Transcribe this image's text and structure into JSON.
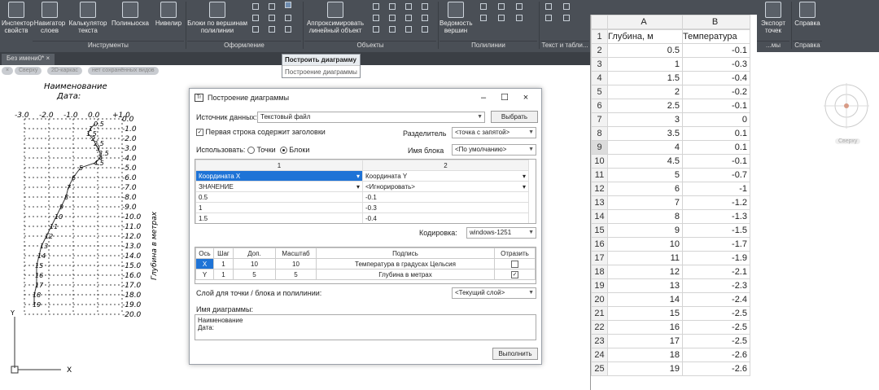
{
  "ribbon": {
    "buttons": [
      {
        "label": "Инспектор свойств",
        "icon": "inspector-icon"
      },
      {
        "label": "Навигатор слоев",
        "icon": "layers-icon"
      },
      {
        "label": "Калькулятор текста",
        "icon": "calculator-icon"
      },
      {
        "label": "Полиныоска",
        "icon": "polyline-icon"
      },
      {
        "label": "Нивелир",
        "icon": "level-icon"
      },
      {
        "label": "Блоки по вершинам полилинии",
        "icon": "blocks-icon"
      },
      {
        "label": "Аппроксимировать линейный объект",
        "icon": "approx-icon"
      },
      {
        "label": "Ведомость вершин",
        "icon": "vertex-list-icon"
      },
      {
        "label": "Экспорт точек",
        "icon": "export-icon"
      },
      {
        "label": "Справка",
        "icon": "help-icon"
      }
    ],
    "groups": [
      "Инструменты",
      "Оформление",
      "Объекты",
      "Полилинии",
      "Текст и табли...",
      "...мы",
      "Справка"
    ]
  },
  "doc_tab": "Без имени0*",
  "view_pills": [
    "Сверху",
    "2D-каркас",
    "нет сохранённых видов"
  ],
  "tooltip": {
    "title": "Построить диаграмму",
    "desc": "Построение диаграммы"
  },
  "drawing": {
    "title": "Наименование",
    "subtitle": "Дата:",
    "x_ticks": [
      "-3.0",
      "-2.0",
      "-1.0",
      "0.0",
      "+1.0"
    ],
    "y_ticks": [
      "0.0",
      "-1.0",
      "-2.0",
      "-3.0",
      "-4.0",
      "-5.0",
      "-6.0",
      "-7.0",
      "-8.0",
      "-9.0",
      "-10.0",
      "-11.0",
      "-12.0",
      "-13.0",
      "-14.0",
      "-15.0",
      "-16.0",
      "-17.0",
      "-18.0",
      "-19.0",
      "-20.0"
    ],
    "ylabel": "Глубина в метрах",
    "axis_y": "Y",
    "axis_x": "X"
  },
  "dialog": {
    "title": "Построение диаграммы",
    "source_label": "Источник данных:",
    "source_value": "Текстовый файл",
    "choose_btn": "Выбрать",
    "first_row_headers": "Первая строка содержит заголовки",
    "separator_label": "Разделитель",
    "separator_value": "<точка с запятой>",
    "use_label": "Использовать:",
    "points": "Точки",
    "blocks": "Блоки",
    "block_name_label": "Имя блока",
    "block_name_value": "<По умолчанию>",
    "grid_headers": [
      "1",
      "2"
    ],
    "grid_rows": [
      [
        "Координата X",
        "Координата Y"
      ],
      [
        "ЗНАЧЕНИЕ",
        "<Игнорировать>"
      ],
      [
        "0.5",
        "-0.1"
      ],
      [
        "1",
        "-0.3"
      ],
      [
        "1.5",
        "-0.4"
      ]
    ],
    "encoding_label": "Кодировка:",
    "encoding_value": "windows-1251",
    "axis_headers": [
      "Ось",
      "Шаг",
      "Доп.",
      "Масштаб",
      "Подпись",
      "Отразить"
    ],
    "axis_rows": [
      [
        "X",
        "1",
        "10",
        "10",
        "Температура в градусах Цельсия",
        ""
      ],
      [
        "Y",
        "1",
        "5",
        "5",
        "Глубина в метрах",
        "✓"
      ]
    ],
    "layer_label": "Слой для точки / блока и полилинии:",
    "layer_value": "<Текущий слой>",
    "name_label": "Имя диаграммы:",
    "name_lines": [
      "Наименование",
      "Дата:"
    ],
    "run_btn": "Выполнить"
  },
  "sheet": {
    "col_headers": [
      "A",
      "B"
    ],
    "rows": [
      [
        "1",
        "Глубина, м",
        "Температура"
      ],
      [
        "2",
        "0.5",
        "-0.1"
      ],
      [
        "3",
        "1",
        "-0.3"
      ],
      [
        "4",
        "1.5",
        "-0.4"
      ],
      [
        "5",
        "2",
        "-0.2"
      ],
      [
        "6",
        "2.5",
        "-0.1"
      ],
      [
        "7",
        "3",
        "0"
      ],
      [
        "8",
        "3.5",
        "0.1"
      ],
      [
        "9",
        "4",
        "0.1"
      ],
      [
        "10",
        "4.5",
        "-0.1"
      ],
      [
        "11",
        "5",
        "-0.7"
      ],
      [
        "12",
        "6",
        "-1"
      ],
      [
        "13",
        "7",
        "-1.2"
      ],
      [
        "14",
        "8",
        "-1.3"
      ],
      [
        "15",
        "9",
        "-1.5"
      ],
      [
        "16",
        "10",
        "-1.7"
      ],
      [
        "17",
        "11",
        "-1.9"
      ],
      [
        "18",
        "12",
        "-2.1"
      ],
      [
        "19",
        "13",
        "-2.3"
      ],
      [
        "20",
        "14",
        "-2.4"
      ],
      [
        "21",
        "15",
        "-2.5"
      ],
      [
        "22",
        "16",
        "-2.5"
      ],
      [
        "23",
        "17",
        "-2.5"
      ],
      [
        "24",
        "18",
        "-2.6"
      ],
      [
        "25",
        "19",
        "-2.6"
      ]
    ]
  },
  "compass_label": "Сверху"
}
